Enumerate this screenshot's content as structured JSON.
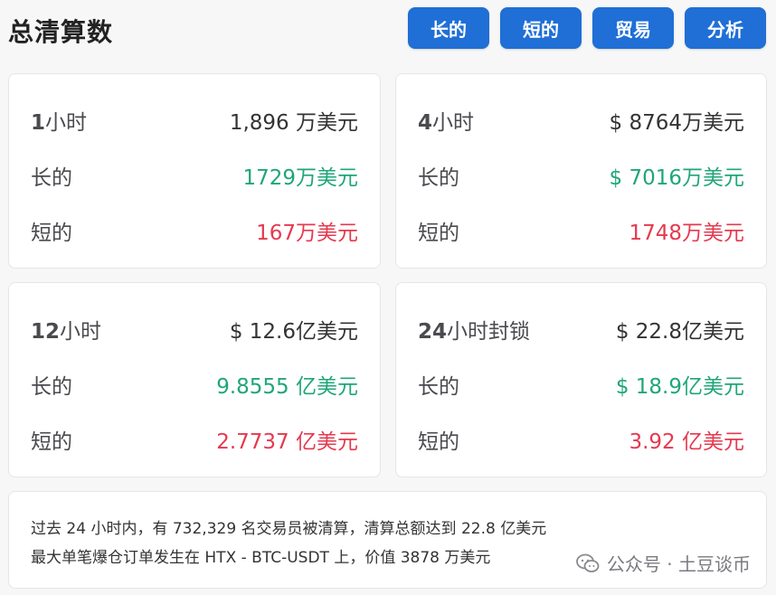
{
  "title": "总清算数",
  "buttons": [
    "长的",
    "短的",
    "贸易",
    "分析"
  ],
  "cards": [
    {
      "period_num": "1",
      "period_unit": "小时",
      "total": "1,896 万美元",
      "long_label": "长的",
      "long_value": "1729万美元",
      "short_label": "短的",
      "short_value": "167万美元"
    },
    {
      "period_num": "4",
      "period_unit": "小时",
      "total": "$ 8764万美元",
      "long_label": "长的",
      "long_value": "$ 7016万美元",
      "short_label": "短的",
      "short_value": "1748万美元"
    },
    {
      "period_num": "12",
      "period_unit": "小时",
      "total": "$ 12.6亿美元",
      "long_label": "长的",
      "long_value": "9.8555 亿美元",
      "short_label": "短的",
      "short_value": "2.7737 亿美元"
    },
    {
      "period_num": "24",
      "period_unit": "小时封锁",
      "total": "$ 22.8亿美元",
      "long_label": "长的",
      "long_value": "$ 18.9亿美元",
      "short_label": "短的",
      "short_value": "3.92 亿美元"
    }
  ],
  "note": {
    "line1": "过去 24 小时内，有 732,329 名交易员被清算，清算总额达到 22.8 亿美元",
    "line2": "最大单笔爆仓订单发生在 HTX - BTC-USDT 上，价值 3878 万美元"
  },
  "watermark": "公众号 · 土豆谈币",
  "colors": {
    "button": "#1f6fd6",
    "long": "#1fa67a",
    "short": "#e5394f"
  }
}
